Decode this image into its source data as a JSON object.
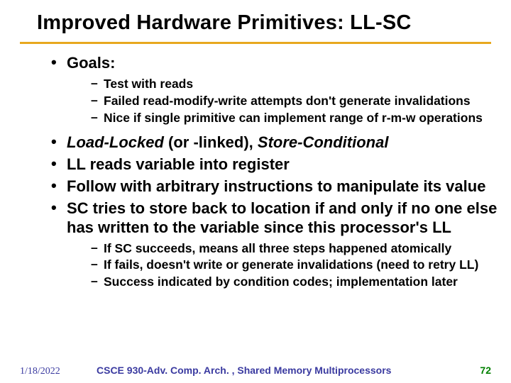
{
  "title": "Improved Hardware Primitives: LL-SC",
  "bullets": {
    "goals": {
      "label": "Goals:",
      "sub": [
        "Test with reads",
        "Failed read-modify-write attempts don't generate invalidations",
        "Nice if single primitive can implement range of r-m-w operations"
      ]
    },
    "llsc_prefix": "Load-Locked",
    "llsc_mid": " (or -linked), ",
    "llsc_suffix": "Store-Conditional",
    "ll_reads": "LL reads variable into register",
    "follow": "Follow with arbitrary instructions to manipulate its value",
    "sc": {
      "label": "SC tries to store back to location if and only if no one else has written to the variable since this processor's LL",
      "sub": [
        "If SC succeeds, means all three steps happened atomically",
        "If fails, doesn't write or generate invalidations (need to retry LL)",
        "Success indicated by condition codes; implementation later"
      ]
    }
  },
  "footer": {
    "date": "1/18/2022",
    "course": "CSCE 930-Adv. Comp. Arch. , Shared Memory Multiprocessors",
    "page": "72"
  }
}
